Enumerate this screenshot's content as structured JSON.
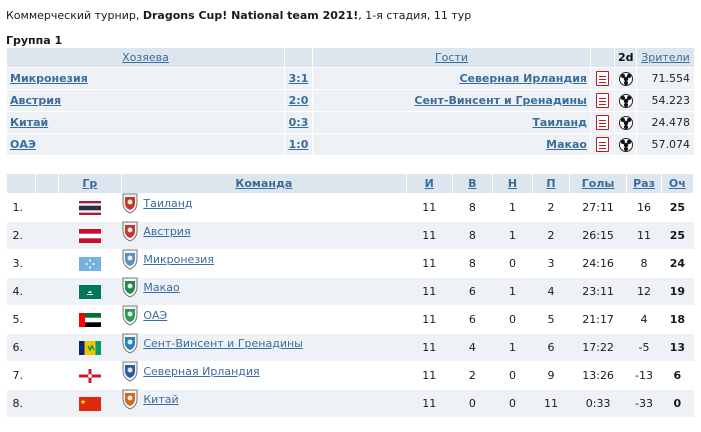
{
  "header": {
    "prefix": "Коммерческий турнир, ",
    "tournament": "Dragons Cup! National team 2021!",
    "suffix": ", 1-я стадия, 11 тур"
  },
  "group_title": "Группа 1",
  "matches": {
    "headers": {
      "home": "Хозяева",
      "guests": "Гости",
      "d2": "2d",
      "spectators": "Зрители"
    },
    "rows": [
      {
        "home": "Микронезия",
        "score": "3:1",
        "guest": "Северная Ирландия",
        "spectators": "71.554"
      },
      {
        "home": "Австрия",
        "score": "2:0",
        "guest": "Сент-Винсент и Гренадины",
        "spectators": "54.223"
      },
      {
        "home": "Китай",
        "score": "0:3",
        "guest": "Таиланд",
        "spectators": "24.478"
      },
      {
        "home": "ОАЭ",
        "score": "1:0",
        "guest": "Макао",
        "spectators": "57.074"
      }
    ]
  },
  "standings": {
    "headers": {
      "group": "Гр",
      "team": "Команда",
      "games": "И",
      "wins": "В",
      "draws": "Н",
      "losses": "П",
      "goals": "Голы",
      "diff": "Раз",
      "points": "Оч"
    },
    "rows": [
      {
        "pos": "1.",
        "flag": "thailand",
        "team": "Таиланд",
        "games": "11",
        "wins": "8",
        "draws": "1",
        "losses": "2",
        "goals": "27:11",
        "diff": "16",
        "points": "25"
      },
      {
        "pos": "2.",
        "flag": "austria",
        "team": "Австрия",
        "games": "11",
        "wins": "8",
        "draws": "1",
        "losses": "2",
        "goals": "26:15",
        "diff": "11",
        "points": "25"
      },
      {
        "pos": "3.",
        "flag": "micronesia",
        "team": "Микронезия",
        "games": "11",
        "wins": "8",
        "draws": "0",
        "losses": "3",
        "goals": "24:16",
        "diff": "8",
        "points": "24"
      },
      {
        "pos": "4.",
        "flag": "macao",
        "team": "Макао",
        "games": "11",
        "wins": "6",
        "draws": "1",
        "losses": "4",
        "goals": "23:11",
        "diff": "12",
        "points": "19"
      },
      {
        "pos": "5.",
        "flag": "uae",
        "team": "ОАЭ",
        "games": "11",
        "wins": "6",
        "draws": "0",
        "losses": "5",
        "goals": "21:17",
        "diff": "4",
        "points": "18"
      },
      {
        "pos": "6.",
        "flag": "saint-vincent",
        "team": "Сент-Винсент и Гренадины",
        "games": "11",
        "wins": "4",
        "draws": "1",
        "losses": "6",
        "goals": "17:22",
        "diff": "-5",
        "points": "13"
      },
      {
        "pos": "7.",
        "flag": "northern-ireland",
        "team": "Северная Ирландия",
        "games": "11",
        "wins": "2",
        "draws": "0",
        "losses": "9",
        "goals": "13:26",
        "diff": "-13",
        "points": "6"
      },
      {
        "pos": "8.",
        "flag": "china",
        "team": "Китай",
        "games": "11",
        "wins": "0",
        "draws": "0",
        "losses": "11",
        "goals": "0:33",
        "diff": "-33",
        "points": "0"
      }
    ]
  },
  "colors": {
    "link": "#3a6d9c",
    "header_bg": "#dde6ee",
    "row_alt": "#eef2f6"
  }
}
